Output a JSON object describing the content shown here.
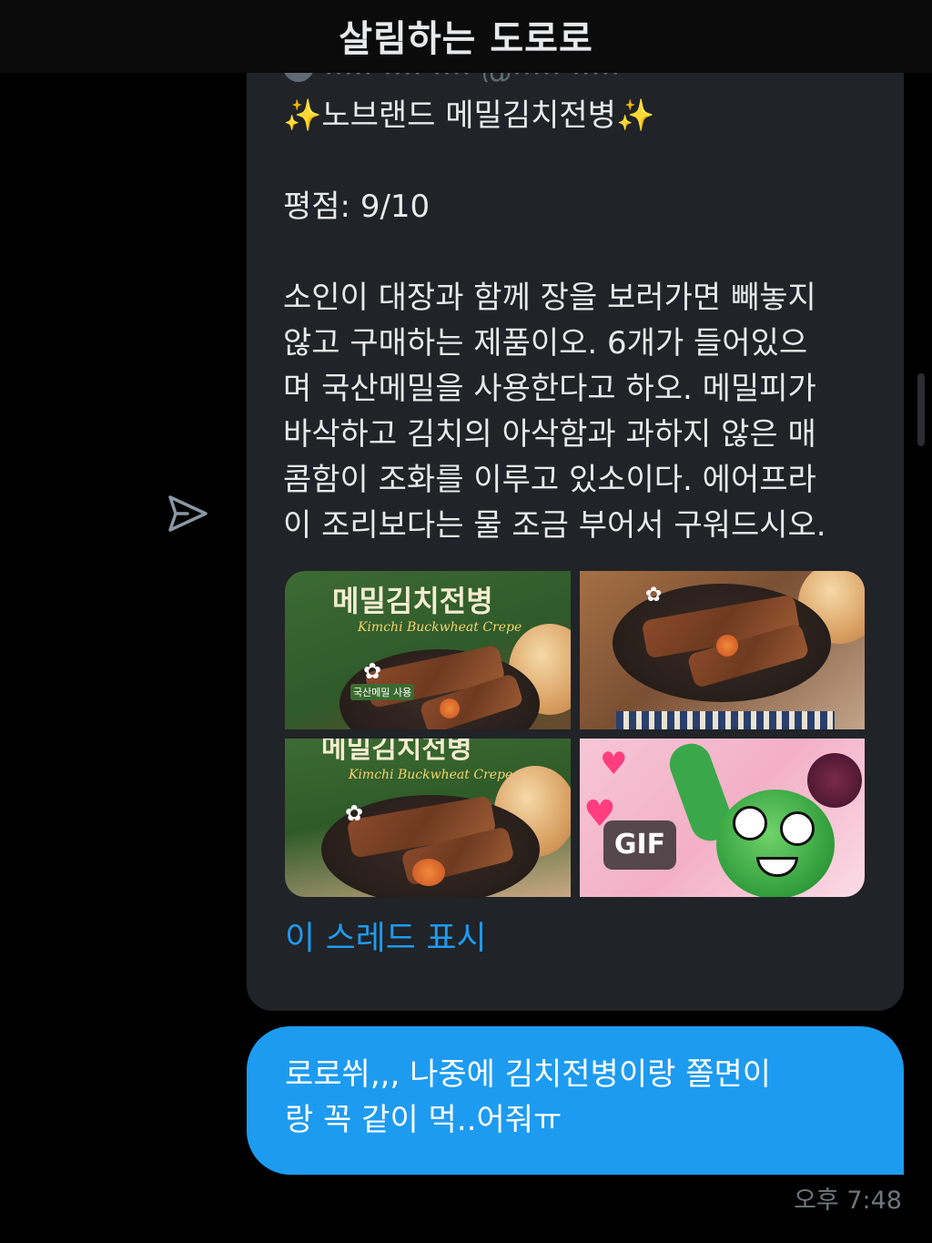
{
  "header": {
    "title": "살림하는 도로로"
  },
  "shared_tweet": {
    "header_partial": "····· ···· ···· @····· ·····",
    "title": "노브랜드 메밀김치전병",
    "title_emoji": "✨",
    "rating": "평점: 9/10",
    "body_lines": [
      "소인이 대장과 함께 장을 보러가면 빼놓지",
      "않고 구매하는 제품이오. 6개가 들어있으",
      "며 국산메밀을 사용한다고 하오. 메밀피가",
      "바삭하고 김치의 아삭함과 과하지 않은 매",
      "콤함이 조화를 이루고 있소이다. 에어프라",
      "이 조리보다는 물 조금 부어서 구워드시오."
    ],
    "media": {
      "package_title": "메밀김치전병",
      "package_subtitle": "Kimchi Buckwheat Crepe",
      "package_badge": "국산메밀 사용",
      "gif_label": "GIF"
    },
    "thread_link": "이 스레드 표시"
  },
  "message": {
    "lines": [
      "로로쒸,,, 나중에 김치전병이랑 쫄면이",
      "랑 꼭 같이 먹..어줘ㅠ"
    ],
    "time": "오후 7:48"
  },
  "colors": {
    "background": "#000000",
    "card": "#202327",
    "bubble": "#1d9bf0",
    "link": "#1d9bf0",
    "text": "#e7e9ea",
    "muted": "#6e767d"
  },
  "icons": {
    "share": "send-icon"
  }
}
